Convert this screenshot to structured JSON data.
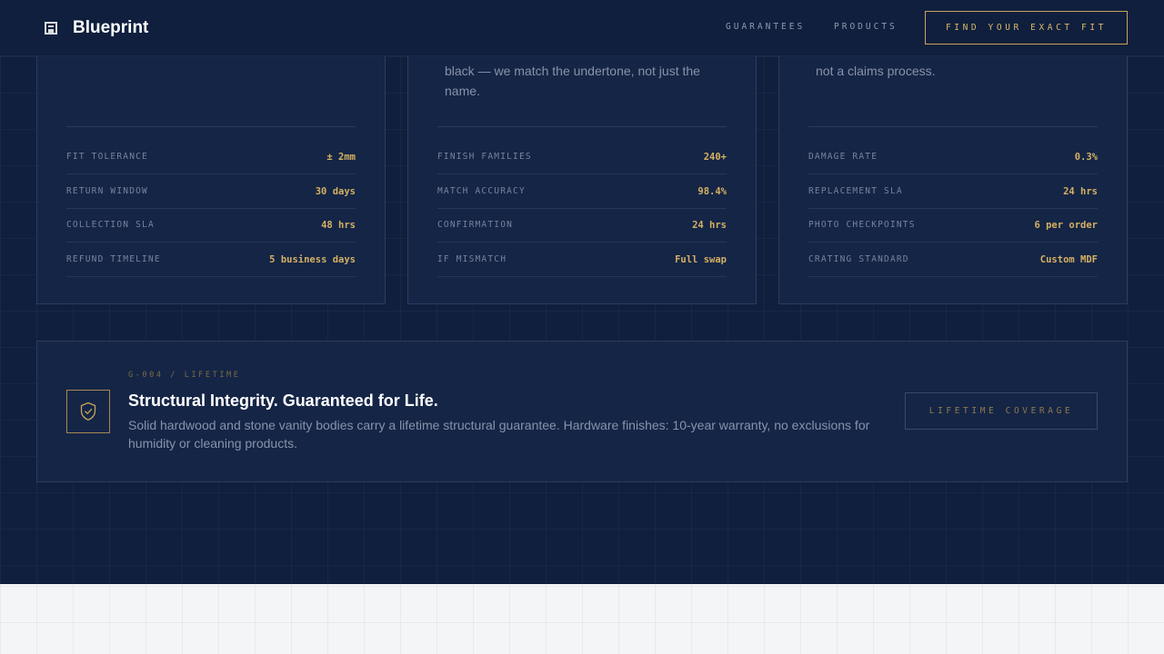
{
  "header": {
    "brand": "Blueprint",
    "nav": [
      {
        "label": "GUARANTEES"
      },
      {
        "label": "PRODUCTS"
      }
    ],
    "cta_label": "FIND YOUR EXACT FIT"
  },
  "cards": [
    {
      "description": "",
      "specs": [
        {
          "label": "FIT TOLERANCE",
          "value": "± 2mm"
        },
        {
          "label": "RETURN WINDOW",
          "value": "30 days"
        },
        {
          "label": "COLLECTION SLA",
          "value": "48 hrs"
        },
        {
          "label": "REFUND TIMELINE",
          "value": "5 business days"
        }
      ]
    },
    {
      "description": "black — we match the undertone, not just the name.",
      "specs": [
        {
          "label": "FINISH FAMILIES",
          "value": "240+"
        },
        {
          "label": "MATCH ACCURACY",
          "value": "98.4%"
        },
        {
          "label": "CONFIRMATION",
          "value": "24 hrs"
        },
        {
          "label": "IF MISMATCH",
          "value": "Full swap"
        }
      ]
    },
    {
      "description": "not a claims process.",
      "specs": [
        {
          "label": "DAMAGE RATE",
          "value": "0.3%"
        },
        {
          "label": "REPLACEMENT SLA",
          "value": "24 hrs"
        },
        {
          "label": "PHOTO CHECKPOINTS",
          "value": "6 per order"
        },
        {
          "label": "CRATING STANDARD",
          "value": "Custom MDF"
        }
      ]
    }
  ],
  "banner": {
    "code": "G-004 / LIFETIME",
    "title": "Structural Integrity. Guaranteed for Life.",
    "description": "Solid hardwood and stone vanity bodies carry a lifetime structural guarantee. Hardware finishes: 10-year warranty, no exclusions for humidity or cleaning products.",
    "button_label": "LIFETIME COVERAGE",
    "icon": "shield-check-icon"
  },
  "colors": {
    "background": "#0f1f3d",
    "card": "#152546",
    "accent": "#c8a55a",
    "light_section": "#f3f5f7"
  }
}
